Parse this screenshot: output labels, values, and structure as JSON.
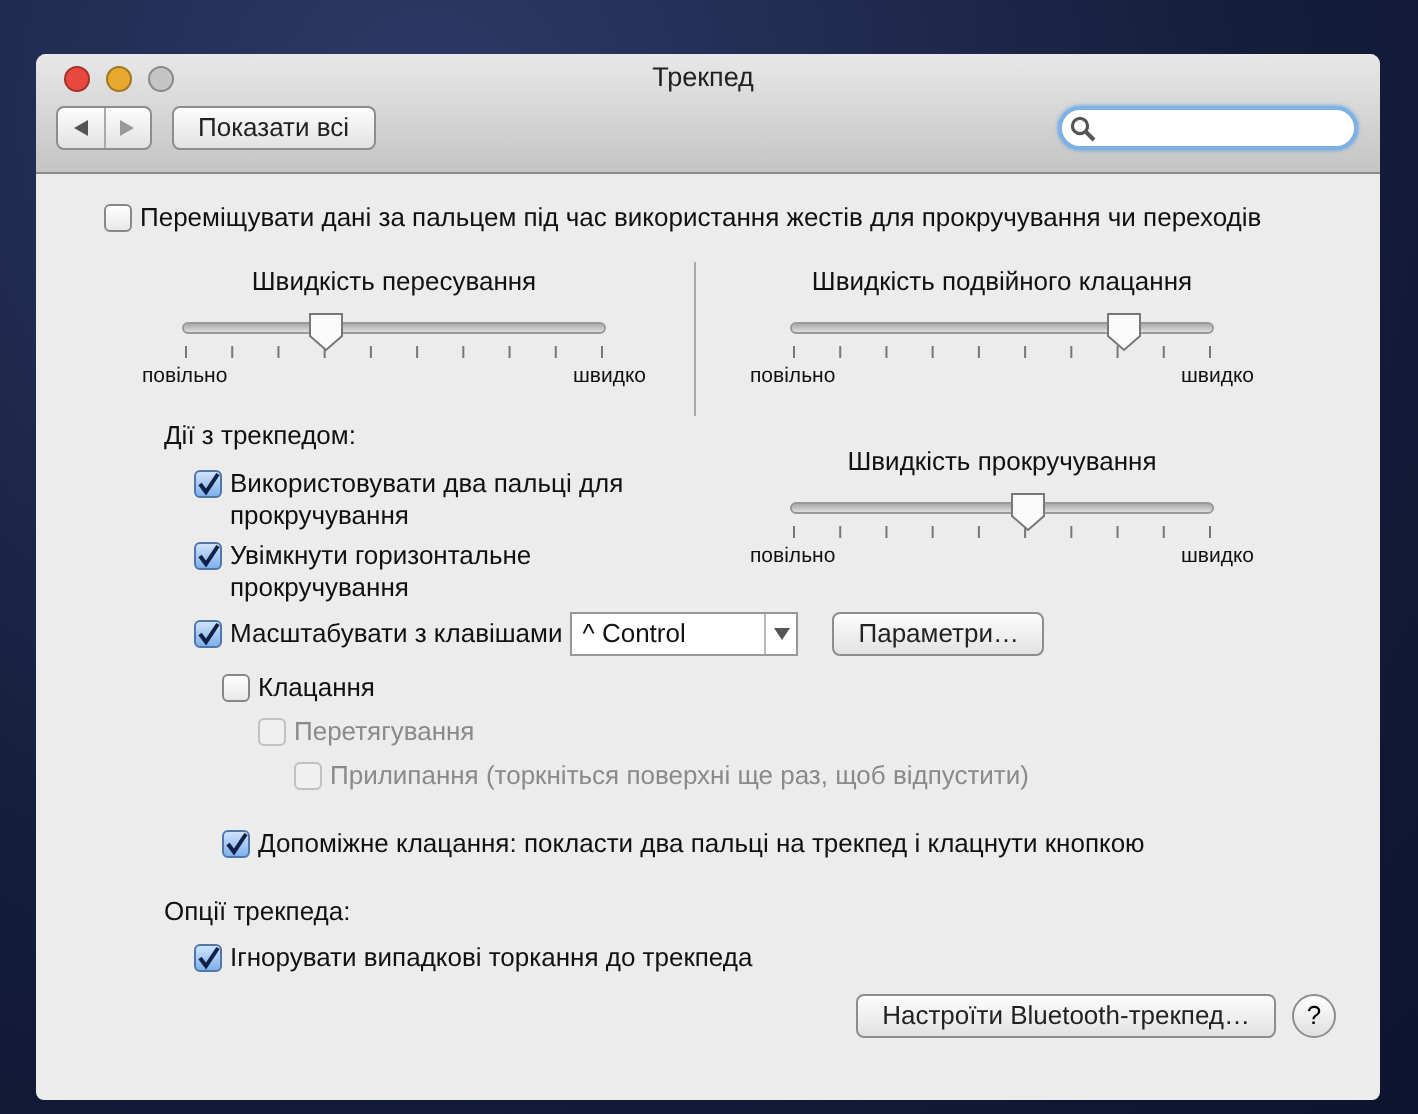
{
  "window": {
    "title": "Трекпед"
  },
  "toolbar": {
    "show_all_button": "Показати всі"
  },
  "follow_finger": {
    "label": "Переміщувати дані за пальцем під час використання жестів для прокручування чи переходів",
    "checked": false
  },
  "sliders": [
    {
      "title": "Швидкість пересування",
      "level": 0.34,
      "min_label": "повільно",
      "max_label": "швидко"
    },
    {
      "title": "Швидкість подвійного клацання",
      "level": 0.79,
      "min_label": "повільно",
      "max_label": "швидко"
    },
    {
      "title": "Швидкість прокручування",
      "level": 0.56,
      "min_label": "повільно",
      "max_label": "швидко"
    }
  ],
  "actions": {
    "heading": "Дії з трекпедом:",
    "items": [
      {
        "kind": "check",
        "label": "Використовувати два пальці для прокручування",
        "checked": true,
        "disabled": false
      },
      {
        "kind": "check",
        "label": "Увімкнути горизонтальне прокручування",
        "checked": true,
        "disabled": false
      },
      {
        "kind": "dropdown",
        "label": "Масштабувати з клавішами",
        "checked": true,
        "disabled": false,
        "value": "^ Control",
        "button": "Параметри…"
      }
    ]
  },
  "clicking": [
    {
      "label": "Клацання",
      "checked": false,
      "disabled": false,
      "children": [
        {
          "label": "Перетягування",
          "checked": false,
          "disabled": true,
          "children": [
            {
              "label": "Прилипання (торкніться поверхні ще раз, щоб відпустити)",
              "checked": false,
              "disabled": true
            }
          ]
        }
      ]
    },
    {
      "label": "Допоміжне клацання: покласти два пальці на трекпед і клацнути кнопкою",
      "checked": true,
      "disabled": false
    }
  ],
  "options": {
    "heading": "Опції трекпеда:",
    "items": [
      {
        "label": "Ігнорувати випадкові торкання до трекпеда",
        "checked": true,
        "disabled": false
      }
    ]
  },
  "footer": {
    "bluetooth_button": "Настроїти Bluetooth-трекпед…",
    "help_button": "?"
  }
}
